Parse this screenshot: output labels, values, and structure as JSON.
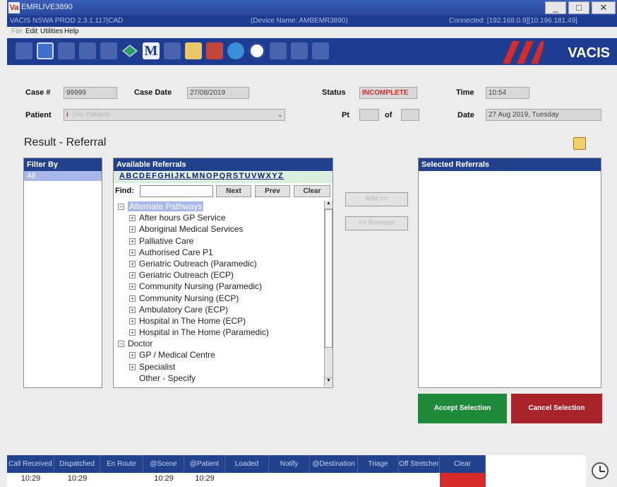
{
  "window": {
    "logo": "Va",
    "title": "EMRLIVE3890",
    "min": "_",
    "max": "□",
    "close": "✕"
  },
  "info": {
    "left": "VACIS NSWA PROD 2.3.1.117|CAD",
    "center": "(Device Name: AMBEMR3890)",
    "right": "Connected: [192.168.0.9][10.196.181.49]"
  },
  "menu": [
    "File",
    "Edit",
    "Utilities",
    "Help"
  ],
  "toolbar": {
    "logo": "VACIS",
    "m_label": "M"
  },
  "case": {
    "case_label": "Case #",
    "case_value": "99999",
    "date_label": "Case Date",
    "date_value": "27/08/2019",
    "status_label": "Status",
    "status_value": "INCOMPLETE",
    "time_label": "Time",
    "time_value": "10:54",
    "patient_label": "Patient",
    "patient_icon": "i",
    "patient_placeholder": "(No Patient)",
    "pt_label": "Pt",
    "of_label": "of",
    "date2_label": "Date",
    "date2_value": "27 Aug 2019, Tuesday"
  },
  "section_title": "Result - Referral",
  "filter": {
    "header": "Filter By",
    "items": [
      "All"
    ]
  },
  "available": {
    "header": "Available Referrals",
    "alphabet": "ABCDEFGHIJKLMNOPQRSTUVWXYZ",
    "find_label": "Find:",
    "next": "Next",
    "prev": "Prev",
    "clear": "Clear",
    "tree": [
      {
        "t": "Alternate Pathways",
        "lvl": 0,
        "exp": "⊟",
        "sel": true
      },
      {
        "t": "After hours GP Service",
        "lvl": 1,
        "exp": "⊞"
      },
      {
        "t": "Aboriginal Medical Services",
        "lvl": 1,
        "exp": "⊞"
      },
      {
        "t": "Palliative Care",
        "lvl": 1,
        "exp": "⊞"
      },
      {
        "t": "Authorised Care P1",
        "lvl": 1,
        "exp": "⊞"
      },
      {
        "t": "Geriatric Outreach (Paramedic)",
        "lvl": 1,
        "exp": "⊞"
      },
      {
        "t": "Geriatric Outreach (ECP)",
        "lvl": 1,
        "exp": "⊞"
      },
      {
        "t": "Community Nursing (Paramedic)",
        "lvl": 1,
        "exp": "⊞"
      },
      {
        "t": "Community Nursing (ECP)",
        "lvl": 1,
        "exp": "⊞"
      },
      {
        "t": "Ambulatory Care (ECP)",
        "lvl": 1,
        "exp": "⊞"
      },
      {
        "t": "Hospital in The Home (ECP)",
        "lvl": 1,
        "exp": "⊞"
      },
      {
        "t": "Hospital in The Home (Paramedic)",
        "lvl": 1,
        "exp": "⊞"
      },
      {
        "t": "Doctor",
        "lvl": 0,
        "exp": "⊟"
      },
      {
        "t": "GP / Medical Centre",
        "lvl": 1,
        "exp": "⊞"
      },
      {
        "t": "Specialist",
        "lvl": 1,
        "exp": "⊞"
      },
      {
        "t": "Other - Specify",
        "lvl": 1,
        "exp": ""
      }
    ]
  },
  "actions": {
    "add": "Add >>",
    "remove": "<< Remove",
    "accept": "Accept Selection",
    "cancel": "Cancel Selection"
  },
  "selected": {
    "header": "Selected Referrals"
  },
  "status": {
    "headers": [
      "Call Received",
      "Dispatched",
      "En Route",
      "@Scene",
      "@Patient",
      "Loaded",
      "Notify",
      "@Destination",
      "Triage",
      "Off Stretcher",
      "Clear"
    ],
    "values": [
      "10:29",
      "10:29",
      "",
      "10:29",
      "10:29",
      "",
      "",
      "",
      "",
      "",
      ""
    ]
  },
  "colors": {
    "accent": "#23428e",
    "status_red": "#d52b2b",
    "accept": "#1f8a3a",
    "cancel": "#a8232a",
    "selected_item": "#a8b8e8"
  }
}
